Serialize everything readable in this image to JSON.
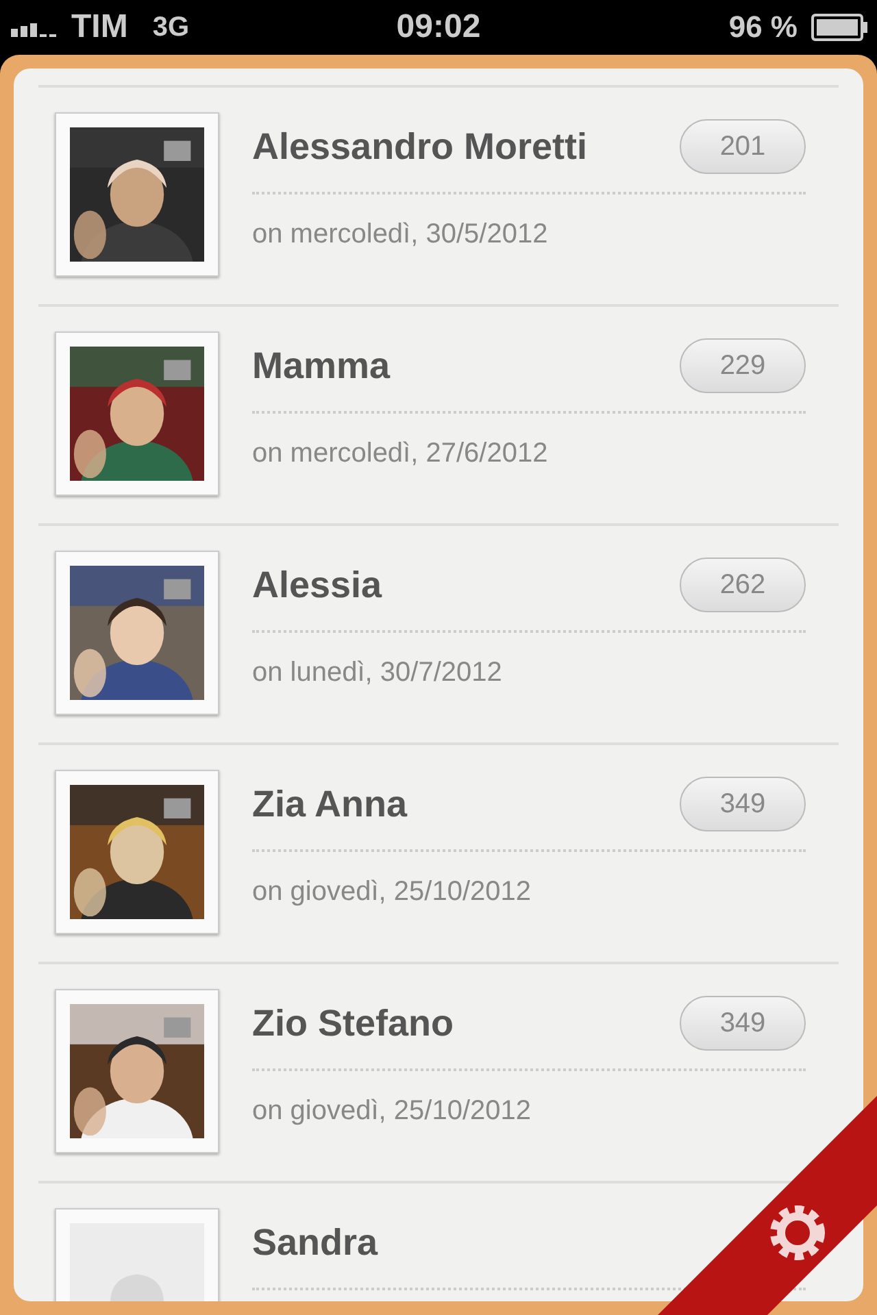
{
  "status_bar": {
    "carrier": "TIM",
    "network": "3G",
    "time": "09:02",
    "battery": "96 %"
  },
  "contacts": [
    {
      "name": "Alessandro Moretti",
      "date": "on mercoledì, 30/5/2012",
      "count": "201",
      "kind": "picture"
    },
    {
      "name": "Mamma",
      "date": "on mercoledì, 27/6/2012",
      "count": "229",
      "kind": "picture"
    },
    {
      "name": "Alessia",
      "date": "on lunedì, 30/7/2012",
      "count": "262",
      "kind": "picture"
    },
    {
      "name": "Zia Anna",
      "date": "on giovedì, 25/10/2012",
      "count": "349",
      "kind": "picture"
    },
    {
      "name": "Zio Stefano",
      "date": "on giovedì, 25/10/2012",
      "count": "349",
      "kind": "picture"
    },
    {
      "name": "Sandra",
      "kind": "silhouette"
    }
  ]
}
